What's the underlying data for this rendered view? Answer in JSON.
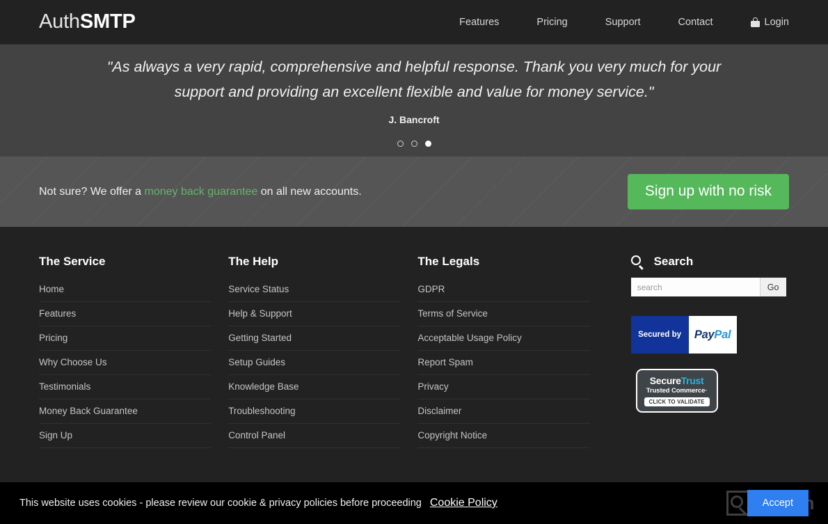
{
  "header": {
    "logo_light": "Auth",
    "logo_bold": "SMTP",
    "nav": [
      {
        "label": "Features",
        "icon": ""
      },
      {
        "label": "Pricing",
        "icon": ""
      },
      {
        "label": "Support",
        "icon": ""
      },
      {
        "label": "Contact",
        "icon": ""
      }
    ],
    "login_label": "Login",
    "login_icon": "padlock-icon"
  },
  "testimonial": {
    "quote": "\"As always a very rapid, comprehensive and helpful response. Thank you very much for your support and providing an excellent flexible and value for money service.\"",
    "author": "J. Bancroft",
    "dots": [
      {
        "active": false
      },
      {
        "active": false
      },
      {
        "active": true
      }
    ]
  },
  "cta": {
    "text_before": "Not sure? We offer a ",
    "link_text": "money back guarantee",
    "text_after": " on all new accounts.",
    "button_label": "Sign up with no risk",
    "button_color": "#55b85a",
    "link_color": "#68b26a"
  },
  "footer": {
    "columns": [
      {
        "title": "The Service",
        "links": [
          "Home",
          "Features",
          "Pricing",
          "Why Choose Us",
          "Testimonials",
          "Money Back Guarantee",
          "Sign Up"
        ]
      },
      {
        "title": "The Help",
        "links": [
          "Service Status",
          "Help & Support",
          "Getting Started",
          "Setup Guides",
          "Knowledge Base",
          "Troubleshooting",
          "Control Panel"
        ]
      },
      {
        "title": "The Legals",
        "links": [
          "GDPR",
          "Terms of Service",
          "Acceptable Usage Policy",
          "Report Spam",
          "Privacy",
          "Disclaimer",
          "Copyright Notice"
        ]
      }
    ],
    "search": {
      "icon": "search-icon",
      "title": "Search",
      "placeholder": "search",
      "value": "",
      "go_label": "Go"
    },
    "paypal_badge": {
      "secured_by": "Secured by",
      "pay": "Pay",
      "pal": "Pal",
      "bg_color": "#123399"
    },
    "securetrust_badge": {
      "secure": "Secure",
      "trust": "Trust",
      "subtitle": "Trusted Commerce·",
      "validate": "CLICK TO VALIDATE",
      "accent_color": "#2bb3e0"
    }
  },
  "cookie_bar": {
    "message": "This website uses cookies - please review our cookie & privacy policies before proceeding",
    "policy_link": "Cookie Policy",
    "accept_label": "Accept",
    "accept_color": "#2f7ff0",
    "watermark_text": "Revain"
  }
}
